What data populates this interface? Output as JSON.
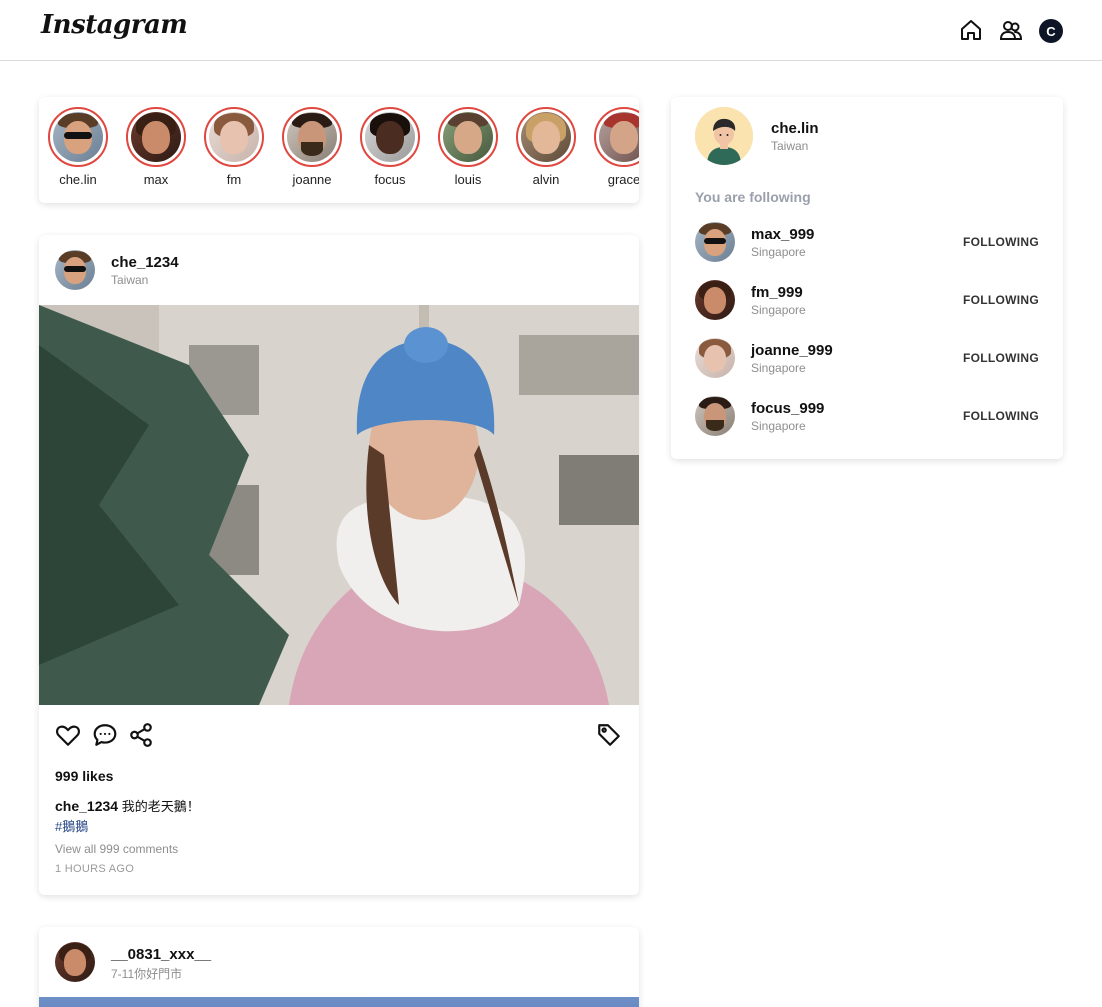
{
  "header": {
    "logo": "Instagram",
    "icons": [
      "home-icon",
      "friends-icon"
    ],
    "profile_initial": "C"
  },
  "stories": [
    {
      "name": "che.lin"
    },
    {
      "name": "max"
    },
    {
      "name": "fm"
    },
    {
      "name": "joanne"
    },
    {
      "name": "focus"
    },
    {
      "name": "louis"
    },
    {
      "name": "alvin"
    },
    {
      "name": "grace"
    }
  ],
  "post": {
    "username": "che_1234",
    "location": "Taiwan",
    "likes": "999 likes",
    "caption_user": "che_1234",
    "caption_text": "我的老天鵝！",
    "hashtag": "#鵝鵝",
    "view_comments": "View all 999 comments",
    "time": "1 HOURS AGO"
  },
  "post2": {
    "username": "__0831_xxx__",
    "location": "7-11你好門市"
  },
  "sidebar": {
    "name": "che.lin",
    "location": "Taiwan",
    "following_title": "You are following",
    "following": [
      {
        "name": "max_999",
        "location": "Singapore",
        "button": "FOLLOWING"
      },
      {
        "name": "fm_999",
        "location": "Singapore",
        "button": "FOLLOWING"
      },
      {
        "name": "joanne_999",
        "location": "Singapore",
        "button": "FOLLOWING"
      },
      {
        "name": "focus_999",
        "location": "Singapore",
        "button": "FOLLOWING"
      }
    ]
  },
  "colors": {
    "story_ring": "#e0473f",
    "hashtag": "#2d4b8a",
    "muted_text": "#8e8e8e",
    "profile_badge": "#0d1526"
  }
}
